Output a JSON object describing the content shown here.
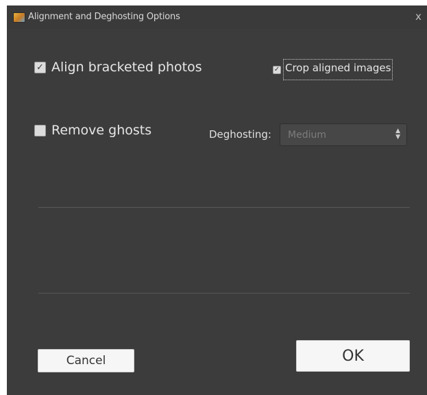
{
  "window": {
    "title": "Alignment and Deghosting Options",
    "close_glyph": "x"
  },
  "options": {
    "align_bracketed": {
      "label": "Align bracketed photos",
      "checked": true,
      "tick": "✓"
    },
    "crop_aligned": {
      "label": "Crop aligned images",
      "checked": true,
      "tick": "✓"
    },
    "remove_ghosts": {
      "label": "Remove ghosts",
      "checked": false
    }
  },
  "deghosting": {
    "label": "Deghosting:",
    "selected": "Medium",
    "arrow_up": "▲",
    "arrow_down": "▼"
  },
  "buttons": {
    "cancel": "Cancel",
    "ok": "OK"
  },
  "colors": {
    "window_bg": "#3c3c3c",
    "button_bg": "#f6f6f6",
    "disabled_text": "#7c7c7c"
  },
  "icons": {
    "app": "photo-merge-icon",
    "close": "close-icon"
  }
}
